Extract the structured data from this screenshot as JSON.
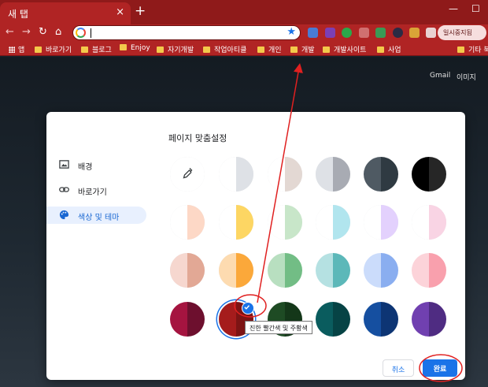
{
  "browser": {
    "tab_title": "새 탭",
    "tab_close_glyph": "×",
    "new_tab_glyph": "+",
    "minimize_glyph": "—",
    "maximize_glyph": "☐",
    "profile_label": "일시중지됨",
    "bookmarks": [
      {
        "label": "앱",
        "kind": "apps"
      },
      {
        "label": "바로가기",
        "kind": "folder"
      },
      {
        "label": "블로그",
        "kind": "folder"
      },
      {
        "label": "Enjoy",
        "kind": "folder"
      },
      {
        "label": "자기개발",
        "kind": "folder"
      },
      {
        "label": "작업아티클",
        "kind": "folder"
      },
      {
        "label": "개인",
        "kind": "folder"
      },
      {
        "label": "개발",
        "kind": "folder"
      },
      {
        "label": "개발사이트",
        "kind": "folder"
      },
      {
        "label": "사업",
        "kind": "folder"
      }
    ],
    "other_bookmarks": "기타 북",
    "theme_colors": {
      "frame": "#8f1a1a",
      "toolbar": "#b02424",
      "accent": "#1a73e8"
    }
  },
  "ntp": {
    "gmail": "Gmail",
    "images": "이미지"
  },
  "dialog": {
    "title": "페이지 맞춤설정",
    "menu": [
      {
        "label": "배경",
        "icon": "image-icon",
        "active": false
      },
      {
        "label": "바로가기",
        "icon": "link-icon",
        "active": false
      },
      {
        "label": "색상 및 테마",
        "icon": "palette-icon",
        "active": true
      }
    ],
    "swatches": [
      [
        "#ffffff",
        "#ffffff"
      ],
      [
        "#ffffff",
        "#dee1e6"
      ],
      [
        "#ffffff",
        "#e3d8d3"
      ],
      [
        "#dee1e6",
        "#a8abb3"
      ],
      [
        "#4f5a63",
        "#2f3a42"
      ],
      [
        "#000000",
        "#262626"
      ],
      [
        "#ffffff",
        "#fdd8c6"
      ],
      [
        "#ffffff",
        "#fdd663"
      ],
      [
        "#ffffff",
        "#c8e6c9"
      ],
      [
        "#ffffff",
        "#b1e5ee"
      ],
      [
        "#ffffff",
        "#e3d1fd"
      ],
      [
        "#ffffff",
        "#f9d4e4"
      ],
      [
        "#f6d7cf",
        "#e2a895"
      ],
      [
        "#fddbb0",
        "#fba83a"
      ],
      [
        "#b8dfc0",
        "#72bd85"
      ],
      [
        "#b5e1e2",
        "#5cb8b9"
      ],
      [
        "#cbdcfb",
        "#8aaef0"
      ],
      [
        "#fcd3d9",
        "#f9a0ad"
      ],
      [
        "#a51440",
        "#6d0f2e"
      ],
      [
        "#a51c1c",
        "#7d1414"
      ],
      [
        "#1e4b24",
        "#143719"
      ],
      [
        "#0a5c5e",
        "#064345"
      ],
      [
        "#154fa0",
        "#0d3574"
      ],
      [
        "#7040b0",
        "#4f2c82"
      ]
    ],
    "selected_index": 19,
    "tooltip": "진한 빨간색 및 주황색",
    "cancel_label": "취소",
    "done_label": "완료"
  }
}
